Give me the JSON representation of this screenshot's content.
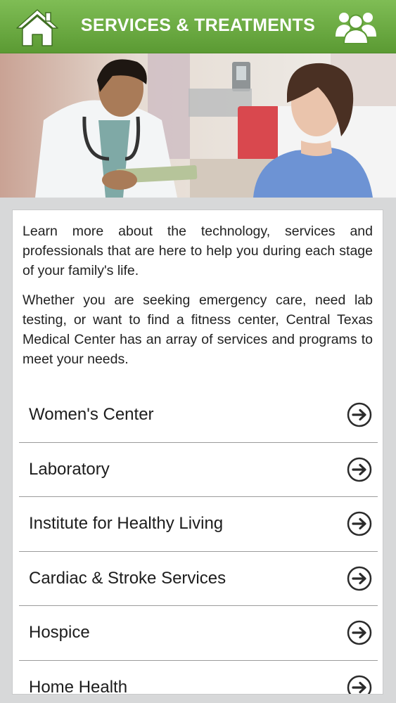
{
  "header": {
    "title": "SERVICES & TREATMENTS",
    "left_icon": "home-icon",
    "right_icon": "people-group-icon"
  },
  "hero": {
    "icon": "doctor-patient-photo"
  },
  "intro": {
    "paragraph_1": "Learn more about the technology, services and professionals that are here to help you during each stage of your family's life.",
    "paragraph_2": "Whether you are seeking emergency care, need lab testing, or want to find a fitness center, Central Texas Medical Center has an array of services and programs to meet your needs."
  },
  "services": [
    {
      "label": "Women's Center",
      "icon": "arrow-right-circle-icon"
    },
    {
      "label": "Laboratory",
      "icon": "arrow-right-circle-icon"
    },
    {
      "label": "Institute for Healthy Living",
      "icon": "arrow-right-circle-icon"
    },
    {
      "label": "Cardiac & Stroke Services",
      "icon": "arrow-right-circle-icon"
    },
    {
      "label": "Hospice",
      "icon": "arrow-right-circle-icon"
    },
    {
      "label": "Home Health",
      "icon": "arrow-right-circle-icon"
    }
  ],
  "colors": {
    "header_green_top": "#7fbd55",
    "header_green_bottom": "#5b9a33",
    "background": "#d7d8d9",
    "card": "#ffffff"
  }
}
